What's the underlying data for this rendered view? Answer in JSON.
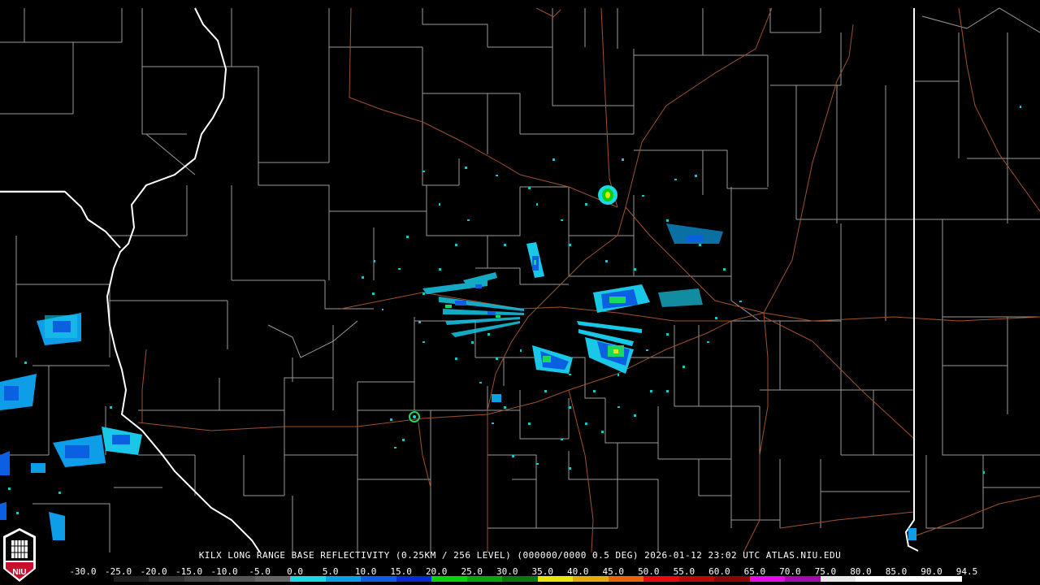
{
  "header": {
    "caption": "KILX LONG RANGE BASE REFLECTIVITY (0.25KM / 256 LEVEL) (000000/0000 0.5 DEG) 2026-01-12 23:02 UTC  ATLAS.NIU.EDU"
  },
  "scale": {
    "labels": [
      "-30.0",
      "-25.0",
      "-20.0",
      "-15.0",
      "-10.0",
      "-5.0",
      "0.0",
      "5.0",
      "10.0",
      "15.0",
      "20.0",
      "25.0",
      "30.0",
      "35.0",
      "40.0",
      "45.0",
      "50.0",
      "55.0",
      "60.0",
      "65.0",
      "70.0",
      "75.0",
      "80.0",
      "85.0",
      "90.0",
      "94.5"
    ],
    "colors": [
      "#000000",
      "#1e1e1e",
      "#333333",
      "#444444",
      "#555555",
      "#666666",
      "#19d9e6",
      "#0e9ee8",
      "#0a60e0",
      "#0a2ad8",
      "#0ad20a",
      "#08a608",
      "#067a06",
      "#e6e60a",
      "#e6a80a",
      "#e6660a",
      "#e60a0a",
      "#b80808",
      "#8a0606",
      "#e60ae6",
      "#a00ab0",
      "#e8e8e8",
      "#ffffff",
      "#ffffff",
      "#ffffff"
    ]
  },
  "logo": {
    "text": "NIU"
  },
  "colors": {
    "background": "#000000",
    "county_lines": "#9a9a9a",
    "state_lines": "#ffffff",
    "highways": "#a0522d"
  }
}
